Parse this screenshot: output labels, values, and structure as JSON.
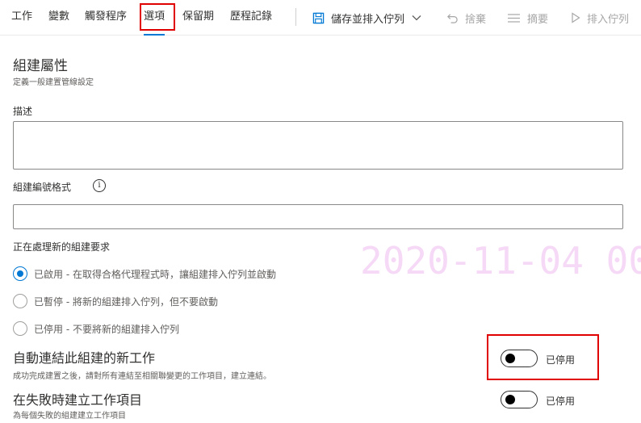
{
  "tabs": [
    {
      "label": "工作"
    },
    {
      "label": "變數"
    },
    {
      "label": "觸發程序"
    },
    {
      "label": "選項"
    },
    {
      "label": "保留期"
    },
    {
      "label": "歷程記錄"
    }
  ],
  "actions": {
    "save_queue": "儲存並排入佇列",
    "discard": "捨棄",
    "summary": "摘要",
    "queue": "排入佇列"
  },
  "section": {
    "title": "組建屬性",
    "subtitle": "定義一般建置管線設定"
  },
  "fields": {
    "description_label": "描述",
    "description_value": "",
    "build_number_label": "組建編號格式",
    "build_number_value": "",
    "info_icon": "i"
  },
  "new_build_requests": {
    "label": "正在處理新的組建要求",
    "options": [
      {
        "label": "已啟用 - 在取得合格代理程式時，讓組建排入佇列並啟動",
        "checked": true
      },
      {
        "label": "已暫停 - 將新的組建排入佇列，但不要啟動",
        "checked": false
      },
      {
        "label": "已停用 - 不要將新的組建排入佇列",
        "checked": false
      }
    ]
  },
  "watermark": "2020-11-04  00",
  "auto_link": {
    "title": "自動連結此組建的新工作",
    "desc": "成功完成建置之後，請對所有連結至相關聯變更的工作項目，建立連結。",
    "toggle_label": "已停用",
    "enabled": false
  },
  "create_work_item": {
    "title": "在失敗時建立工作項目",
    "desc": "為每個失敗的組建建立工作項目",
    "toggle_label": "已停用",
    "enabled": false
  },
  "colors": {
    "accent": "#0078d4",
    "highlight": "#e00000",
    "watermark": "#f6d9f6"
  }
}
